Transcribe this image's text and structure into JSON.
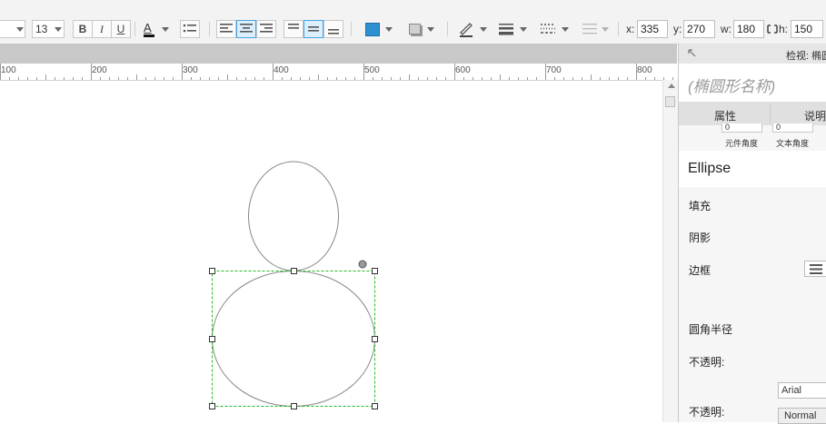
{
  "toolbar": {
    "font_size": "13",
    "bold": "B",
    "italic": "I",
    "underline": "U",
    "font_color": "A",
    "fill_color": "#2e8fd1",
    "coords": {
      "x_label": "x:",
      "x_value": "335",
      "y_label": "y:",
      "y_value": "270",
      "w_label": "w:",
      "w_value": "180",
      "h_label": "h:",
      "h_value": "150"
    }
  },
  "ruler": {
    "labels": [
      "100",
      "200",
      "300",
      "400",
      "500",
      "600",
      "700",
      "800"
    ]
  },
  "panel": {
    "header_title": "检视: 椭圆",
    "name_placeholder": "(椭圆形名称)",
    "tab_properties": "属性",
    "tab_notes": "说明",
    "element_angle_label": "元件角度",
    "text_angle_label": "文本角度",
    "element_angle_value": "0",
    "text_angle_value": "0",
    "shape_name": "Ellipse",
    "fill": "填充",
    "shadow": "阴影",
    "border": "边框",
    "corner_radius": "圆角半径",
    "opacity_1": "不透明:",
    "font_family": "Arial",
    "opacity_2": "不透明:",
    "font_weight": "Normal"
  },
  "colors": {
    "selection": "#22bb22",
    "accent": "#4aa3df"
  }
}
